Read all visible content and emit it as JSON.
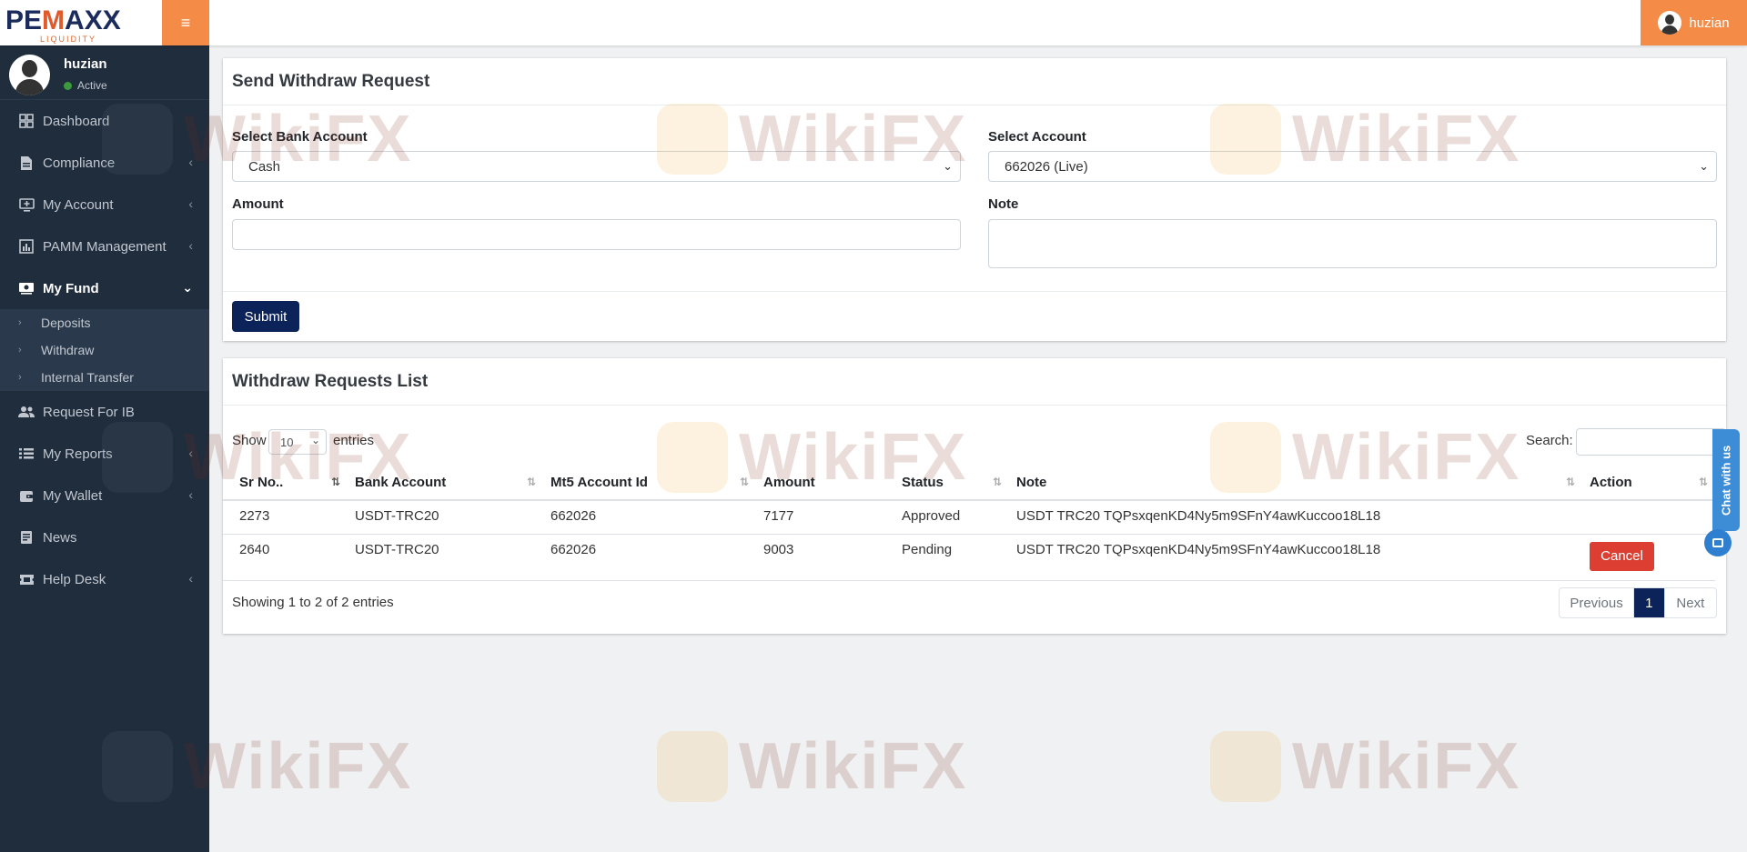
{
  "brand": {
    "logo_main_a": "PE",
    "logo_main_m": "M",
    "logo_main_b": "AXX",
    "logo_sub": "LIQUIDITY"
  },
  "header": {
    "menu_icon": "≡",
    "user_name": "huzian"
  },
  "sidebar": {
    "user_name": "huzian",
    "user_status": "Active",
    "items": [
      {
        "label": "Dashboard",
        "icon": "dashboard-icon"
      },
      {
        "label": "Compliance",
        "icon": "file-icon"
      },
      {
        "label": "My Account",
        "icon": "account-icon"
      },
      {
        "label": "PAMM Management",
        "icon": "chart-icon"
      },
      {
        "label": "My Fund",
        "icon": "fund-icon"
      },
      {
        "label": "Request For IB",
        "icon": "users-icon"
      },
      {
        "label": "My Reports",
        "icon": "list-icon"
      },
      {
        "label": "My Wallet",
        "icon": "wallet-icon"
      },
      {
        "label": "News",
        "icon": "news-icon"
      },
      {
        "label": "Help Desk",
        "icon": "ticket-icon"
      }
    ],
    "sub_items": [
      {
        "label": "Deposits"
      },
      {
        "label": "Withdraw"
      },
      {
        "label": "Internal Transfer"
      }
    ]
  },
  "withdraw_form": {
    "title": "Send Withdraw Request",
    "bank_account_label": "Select Bank Account",
    "bank_account_value": "Cash",
    "account_label": "Select Account",
    "account_value": "662026 (Live)",
    "amount_label": "Amount",
    "note_label": "Note",
    "submit_label": "Submit"
  },
  "requests_list": {
    "title": "Withdraw Requests List",
    "show_label": "Show",
    "entries_label": "entries",
    "page_length": "10",
    "search_label": "Search:",
    "columns": [
      "Sr No..",
      "Bank Account",
      "Mt5 Account Id",
      "Amount",
      "Status",
      "Note",
      "Action"
    ],
    "rows": [
      {
        "sr": "2273",
        "bank": "USDT-TRC20",
        "mt5": "662026",
        "amount": "7177",
        "status": "Approved",
        "note": "USDT TRC20 TQPsxqenKD4Ny5m9SFnY4awKuccoo18L18",
        "action": ""
      },
      {
        "sr": "2640",
        "bank": "USDT-TRC20",
        "mt5": "662026",
        "amount": "9003",
        "status": "Pending",
        "note": "USDT TRC20 TQPsxqenKD4Ny5m9SFnY4awKuccoo18L18",
        "action": "Cancel"
      }
    ],
    "info": "Showing 1 to 2 of 2 entries",
    "pager": {
      "previous": "Previous",
      "current": "1",
      "next": "Next"
    }
  },
  "chat": {
    "label": "Chat with us"
  },
  "watermark": {
    "text": "WikiFX"
  },
  "colors": {
    "sidebar": "#1f2d3d",
    "accent": "#f48c47",
    "primary": "#0c2359",
    "danger": "#dc3f31"
  }
}
